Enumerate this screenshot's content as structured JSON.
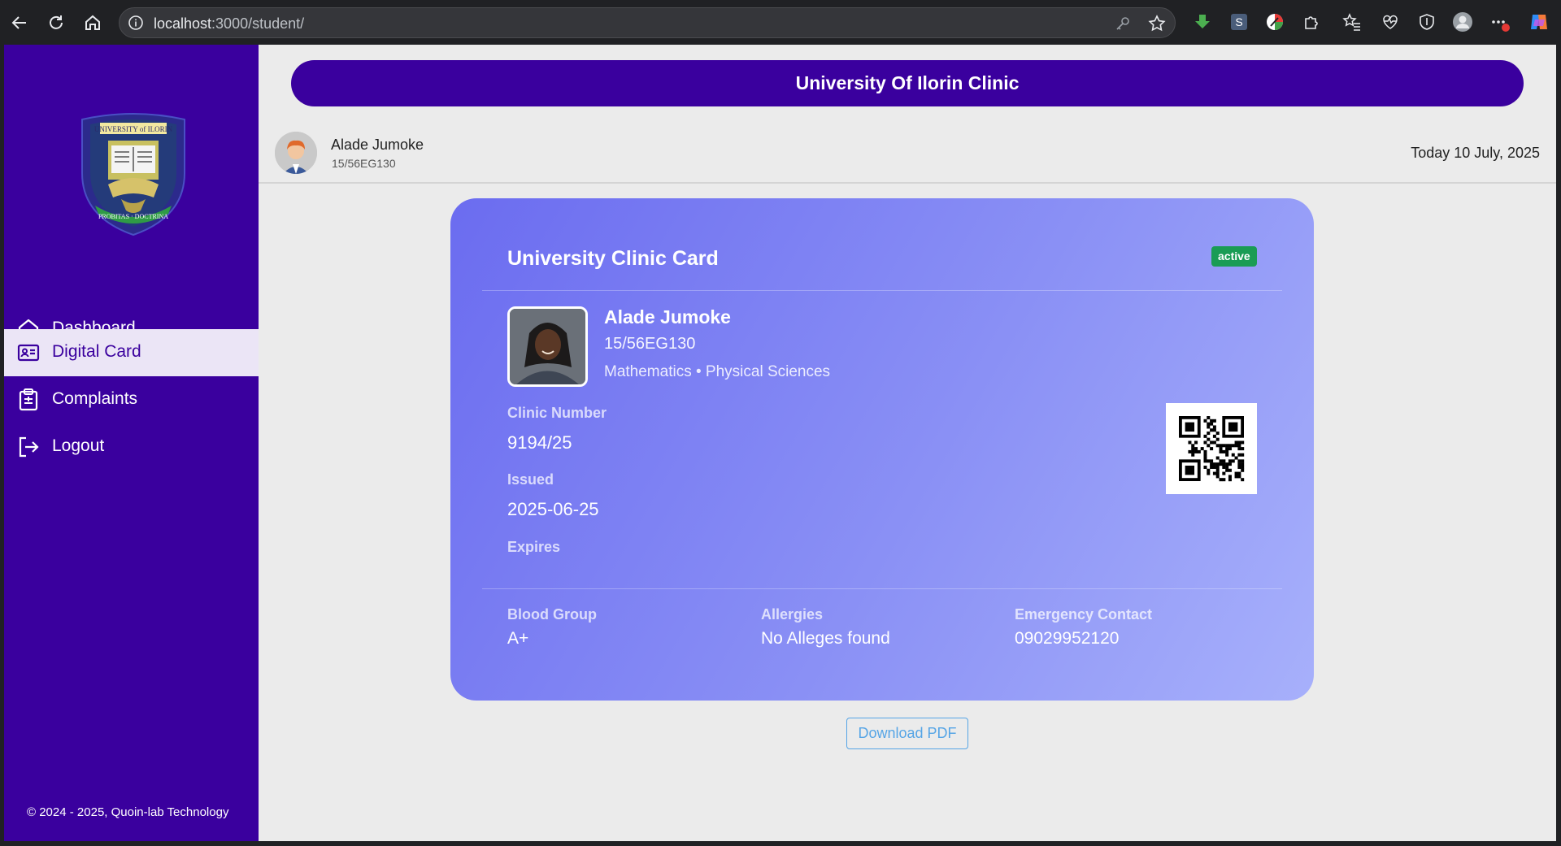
{
  "browser": {
    "url_host": "localhost",
    "url_path": ":3000/student/"
  },
  "sidebar": {
    "items": [
      {
        "label": "Dashboard",
        "icon": "home-icon"
      },
      {
        "label": "Digital Card",
        "icon": "id-card-icon"
      },
      {
        "label": "Complaints",
        "icon": "clipboard-icon"
      },
      {
        "label": "Logout",
        "icon": "logout-icon"
      }
    ],
    "active_index": 1,
    "footer": "© 2024 - 2025, Quoin-lab Technology"
  },
  "header": {
    "title": "University Of Ilorin Clinic"
  },
  "user": {
    "name": "Alade Jumoke",
    "id": "15/56EG130",
    "date": "Today 10 July, 2025"
  },
  "card": {
    "title": "University Clinic Card",
    "status": "active",
    "name": "Alade Jumoke",
    "matric": "15/56EG130",
    "department": "Mathematics • Physical Sciences",
    "clinic_number_label": "Clinic Number",
    "clinic_number": "9194/25",
    "issued_label": "Issued",
    "issued": "2025-06-25",
    "expires_label": "Expires",
    "expires": "",
    "blood_group_label": "Blood Group",
    "blood_group": "A+",
    "allergies_label": "Allergies",
    "allergies": "No Alleges found",
    "emergency_label": "Emergency Contact",
    "emergency": "09029952120"
  },
  "actions": {
    "download_label": "Download PDF"
  },
  "colors": {
    "brand": "#3a009e",
    "active_badge": "#1a9c55",
    "download_accent": "#56a5e6"
  }
}
